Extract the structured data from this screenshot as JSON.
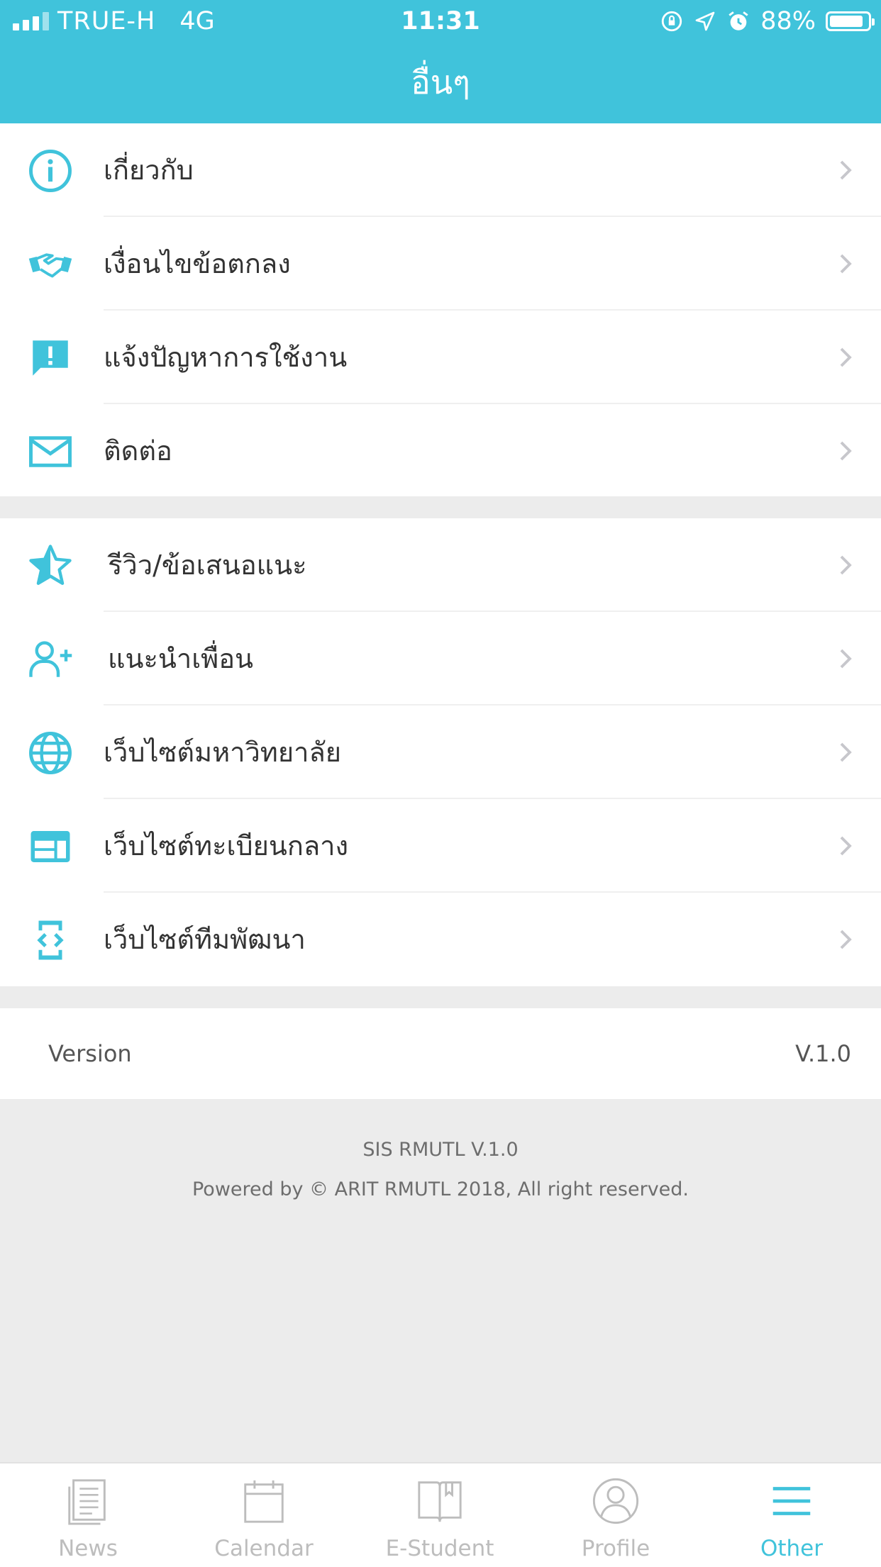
{
  "status_bar": {
    "carrier": "TRUE-H",
    "network": "4G",
    "time": "11:31",
    "battery": "88%",
    "battery_level": 0.88,
    "icons": [
      "signal-icon",
      "orientation-lock-icon",
      "location-icon",
      "alarm-icon",
      "battery-icon"
    ]
  },
  "header": {
    "title": "อื่นๆ"
  },
  "menu_group_1": [
    {
      "label": "เกี่ยวกับ",
      "icon": "info-icon"
    },
    {
      "label": "เงื่อนไขข้อตกลง",
      "icon": "handshake-icon"
    },
    {
      "label": "แจ้งปัญหาการใช้งาน",
      "icon": "feedback-icon"
    },
    {
      "label": "ติดต่อ",
      "icon": "mail-icon"
    }
  ],
  "menu_group_2": [
    {
      "label": "รีวิว/ข้อเสนอแนะ",
      "icon": "star-icon"
    },
    {
      "label": "แนะนำเพื่อน",
      "icon": "add-person-icon"
    },
    {
      "label": "เว็บไซต์มหาวิทยาลัย",
      "icon": "globe-icon"
    },
    {
      "label": "เว็บไซต์ทะเบียนกลาง",
      "icon": "web-icon"
    },
    {
      "label": "เว็บไซต์ทีมพัฒนา",
      "icon": "developer-icon"
    }
  ],
  "version": {
    "label": "Version",
    "value": "V.1.0"
  },
  "footer": {
    "line1": "SIS RMUTL V.1.0",
    "line2": "Powered by © ARIT RMUTL 2018, All right reserved."
  },
  "tabs": [
    {
      "label": "News",
      "icon": "news-icon",
      "active": false
    },
    {
      "label": "Calendar",
      "icon": "calendar-icon",
      "active": false
    },
    {
      "label": "E-Student",
      "icon": "book-icon",
      "active": false
    },
    {
      "label": "Profile",
      "icon": "profile-icon",
      "active": false
    },
    {
      "label": "Other",
      "icon": "menu-icon",
      "active": true
    }
  ],
  "colors": {
    "accent": "#40c3db",
    "background": "#ececec",
    "inactive_tab": "#bdbdbd",
    "chevron": "#c7c7cc"
  }
}
